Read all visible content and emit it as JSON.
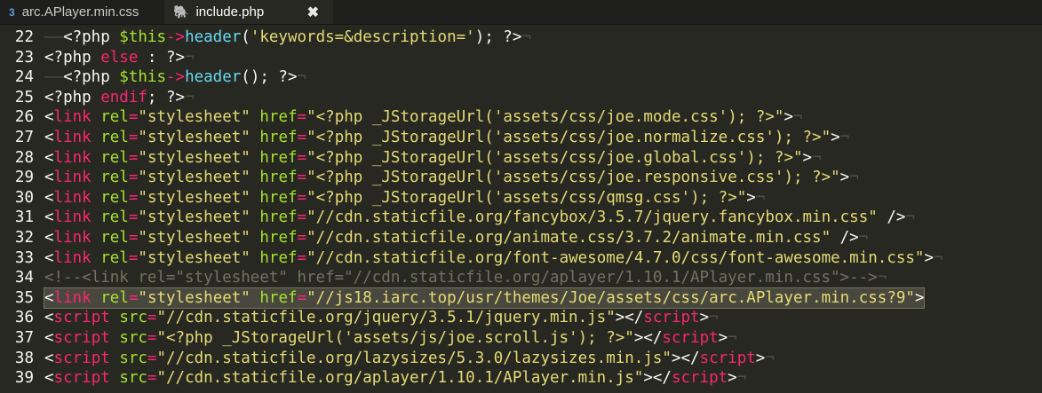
{
  "tabs": [
    {
      "name": "arc.APlayer.min.css",
      "icon": "css-file-icon",
      "active": false
    },
    {
      "name": "include.php",
      "icon": "php-file-icon",
      "active": true,
      "close": "✖"
    }
  ],
  "colors": {
    "background": "#272822",
    "tag": "#f92672",
    "attribute": "#a6e22e",
    "string": "#e6db74",
    "function": "#66d9ef",
    "comment": "#75715e"
  },
  "selected_line": 35,
  "lines": [
    {
      "n": "22",
      "tokens": [
        [
          "ws",
          "——"
        ],
        [
          "default",
          "<?php "
        ],
        [
          "var",
          "$this"
        ],
        [
          "kw",
          "->"
        ],
        [
          "fn",
          "header"
        ],
        [
          "default",
          "("
        ],
        [
          "str",
          "'keywords=&description='"
        ],
        [
          "default",
          "); ?>"
        ],
        [
          "eol",
          "¬"
        ]
      ]
    },
    {
      "n": "23",
      "tokens": [
        [
          "default",
          "<?php "
        ],
        [
          "kw",
          "else"
        ],
        [
          "default",
          " : ?>"
        ],
        [
          "eol",
          "¬"
        ]
      ]
    },
    {
      "n": "24",
      "tokens": [
        [
          "ws",
          "——"
        ],
        [
          "default",
          "<?php "
        ],
        [
          "var",
          "$this"
        ],
        [
          "kw",
          "->"
        ],
        [
          "fn",
          "header"
        ],
        [
          "default",
          "(); ?>"
        ],
        [
          "eol",
          "¬"
        ]
      ]
    },
    {
      "n": "25",
      "tokens": [
        [
          "default",
          "<?php "
        ],
        [
          "kw",
          "endif"
        ],
        [
          "default",
          "; ?>"
        ],
        [
          "eol",
          "¬"
        ]
      ]
    },
    {
      "n": "26",
      "tokens": [
        [
          "default",
          "<"
        ],
        [
          "kw",
          "link"
        ],
        [
          "default",
          " "
        ],
        [
          "attr",
          "rel"
        ],
        [
          "kw",
          "="
        ],
        [
          "str",
          "\"stylesheet\""
        ],
        [
          "default",
          " "
        ],
        [
          "attr",
          "href"
        ],
        [
          "kw",
          "="
        ],
        [
          "str",
          "\"<?php _JStorageUrl("
        ],
        [
          "str",
          "'assets/css/joe.mode.css'"
        ],
        [
          "str",
          "); ?>\""
        ],
        [
          "default",
          ">"
        ],
        [
          "eol",
          "¬"
        ]
      ]
    },
    {
      "n": "27",
      "tokens": [
        [
          "default",
          "<"
        ],
        [
          "kw",
          "link"
        ],
        [
          "default",
          " "
        ],
        [
          "attr",
          "rel"
        ],
        [
          "kw",
          "="
        ],
        [
          "str",
          "\"stylesheet\""
        ],
        [
          "default",
          " "
        ],
        [
          "attr",
          "href"
        ],
        [
          "kw",
          "="
        ],
        [
          "str",
          "\"<?php _JStorageUrl("
        ],
        [
          "str",
          "'assets/css/joe.normalize.css'"
        ],
        [
          "str",
          "); ?>\""
        ],
        [
          "default",
          ">"
        ],
        [
          "eol",
          "¬"
        ]
      ]
    },
    {
      "n": "28",
      "tokens": [
        [
          "default",
          "<"
        ],
        [
          "kw",
          "link"
        ],
        [
          "default",
          " "
        ],
        [
          "attr",
          "rel"
        ],
        [
          "kw",
          "="
        ],
        [
          "str",
          "\"stylesheet\""
        ],
        [
          "default",
          " "
        ],
        [
          "attr",
          "href"
        ],
        [
          "kw",
          "="
        ],
        [
          "str",
          "\"<?php _JStorageUrl("
        ],
        [
          "str",
          "'assets/css/joe.global.css'"
        ],
        [
          "str",
          "); ?>\""
        ],
        [
          "default",
          ">"
        ],
        [
          "eol",
          "¬"
        ]
      ]
    },
    {
      "n": "29",
      "tokens": [
        [
          "default",
          "<"
        ],
        [
          "kw",
          "link"
        ],
        [
          "default",
          " "
        ],
        [
          "attr",
          "rel"
        ],
        [
          "kw",
          "="
        ],
        [
          "str",
          "\"stylesheet\""
        ],
        [
          "default",
          " "
        ],
        [
          "attr",
          "href"
        ],
        [
          "kw",
          "="
        ],
        [
          "str",
          "\"<?php _JStorageUrl("
        ],
        [
          "str",
          "'assets/css/joe.responsive.css'"
        ],
        [
          "str",
          "); ?>\""
        ],
        [
          "default",
          ">"
        ],
        [
          "eol",
          "¬"
        ]
      ]
    },
    {
      "n": "30",
      "tokens": [
        [
          "default",
          "<"
        ],
        [
          "kw",
          "link"
        ],
        [
          "default",
          " "
        ],
        [
          "attr",
          "rel"
        ],
        [
          "kw",
          "="
        ],
        [
          "str",
          "\"stylesheet\""
        ],
        [
          "default",
          " "
        ],
        [
          "attr",
          "href"
        ],
        [
          "kw",
          "="
        ],
        [
          "str",
          "\"<?php _JStorageUrl("
        ],
        [
          "str",
          "'assets/css/qmsg.css'"
        ],
        [
          "str",
          "); ?>\""
        ],
        [
          "default",
          ">"
        ],
        [
          "eol",
          "¬"
        ]
      ]
    },
    {
      "n": "31",
      "tokens": [
        [
          "default",
          "<"
        ],
        [
          "kw",
          "link"
        ],
        [
          "default",
          " "
        ],
        [
          "attr",
          "rel"
        ],
        [
          "kw",
          "="
        ],
        [
          "str",
          "\"stylesheet\""
        ],
        [
          "default",
          " "
        ],
        [
          "attr",
          "href"
        ],
        [
          "kw",
          "="
        ],
        [
          "str",
          "\"//cdn.staticfile.org/fancybox/3.5.7/jquery.fancybox.min.css\""
        ],
        [
          "default",
          " />"
        ],
        [
          "eol",
          "¬"
        ]
      ]
    },
    {
      "n": "32",
      "tokens": [
        [
          "default",
          "<"
        ],
        [
          "kw",
          "link"
        ],
        [
          "default",
          " "
        ],
        [
          "attr",
          "rel"
        ],
        [
          "kw",
          "="
        ],
        [
          "str",
          "\"stylesheet\""
        ],
        [
          "default",
          " "
        ],
        [
          "attr",
          "href"
        ],
        [
          "kw",
          "="
        ],
        [
          "str",
          "\"//cdn.staticfile.org/animate.css/3.7.2/animate.min.css\""
        ],
        [
          "default",
          " />"
        ],
        [
          "eol",
          "¬"
        ]
      ]
    },
    {
      "n": "33",
      "tokens": [
        [
          "default",
          "<"
        ],
        [
          "kw",
          "link"
        ],
        [
          "default",
          " "
        ],
        [
          "attr",
          "rel"
        ],
        [
          "kw",
          "="
        ],
        [
          "str",
          "\"stylesheet\""
        ],
        [
          "default",
          " "
        ],
        [
          "attr",
          "href"
        ],
        [
          "kw",
          "="
        ],
        [
          "str",
          "\"//cdn.staticfile.org/font-awesome/4.7.0/css/font-awesome.min.css\""
        ],
        [
          "default",
          ">"
        ],
        [
          "eol",
          "¬"
        ]
      ]
    },
    {
      "n": "34",
      "tokens": [
        [
          "comment",
          "<!--<link rel=\"stylesheet\" href=\"//cdn.staticfile.org/aplayer/1.10.1/APlayer.min.css\">-->"
        ],
        [
          "eol",
          "¬"
        ]
      ]
    },
    {
      "n": "35",
      "tokens": [
        [
          "default",
          "<"
        ],
        [
          "kw",
          "link"
        ],
        [
          "default",
          " "
        ],
        [
          "attr",
          "rel"
        ],
        [
          "kw",
          "="
        ],
        [
          "str",
          "\"stylesheet\""
        ],
        [
          "default",
          " "
        ],
        [
          "attr",
          "href"
        ],
        [
          "kw",
          "="
        ],
        [
          "str",
          "\"//js18.iarc.top/usr/themes/Joe/assets/css/arc.APlayer.min.css?9\""
        ],
        [
          "default",
          ">"
        ]
      ]
    },
    {
      "n": "36",
      "tokens": [
        [
          "default",
          "<"
        ],
        [
          "kw",
          "script"
        ],
        [
          "default",
          " "
        ],
        [
          "attr",
          "src"
        ],
        [
          "kw",
          "="
        ],
        [
          "str",
          "\"//cdn.staticfile.org/jquery/3.5.1/jquery.min.js\""
        ],
        [
          "default",
          "></"
        ],
        [
          "kw",
          "script"
        ],
        [
          "default",
          ">"
        ],
        [
          "eol",
          "¬"
        ]
      ]
    },
    {
      "n": "37",
      "tokens": [
        [
          "default",
          "<"
        ],
        [
          "kw",
          "script"
        ],
        [
          "default",
          " "
        ],
        [
          "attr",
          "src"
        ],
        [
          "kw",
          "="
        ],
        [
          "str",
          "\"<?php _JStorageUrl("
        ],
        [
          "str",
          "'assets/js/joe.scroll.js'"
        ],
        [
          "str",
          "); ?>\""
        ],
        [
          "default",
          "></"
        ],
        [
          "kw",
          "script"
        ],
        [
          "default",
          ">"
        ],
        [
          "eol",
          "¬"
        ]
      ]
    },
    {
      "n": "38",
      "tokens": [
        [
          "default",
          "<"
        ],
        [
          "kw",
          "script"
        ],
        [
          "default",
          " "
        ],
        [
          "attr",
          "src"
        ],
        [
          "kw",
          "="
        ],
        [
          "str",
          "\"//cdn.staticfile.org/lazysizes/5.3.0/lazysizes.min.js\""
        ],
        [
          "default",
          "></"
        ],
        [
          "kw",
          "script"
        ],
        [
          "default",
          ">"
        ],
        [
          "eol",
          "¬"
        ]
      ]
    },
    {
      "n": "39",
      "tokens": [
        [
          "default",
          "<"
        ],
        [
          "kw",
          "script"
        ],
        [
          "default",
          " "
        ],
        [
          "attr",
          "src"
        ],
        [
          "kw",
          "="
        ],
        [
          "str",
          "\"//cdn.staticfile.org/aplayer/1.10.1/APlayer.min.js\""
        ],
        [
          "default",
          "></"
        ],
        [
          "kw",
          "script"
        ],
        [
          "default",
          ">"
        ],
        [
          "eol",
          "¬"
        ]
      ]
    }
  ]
}
